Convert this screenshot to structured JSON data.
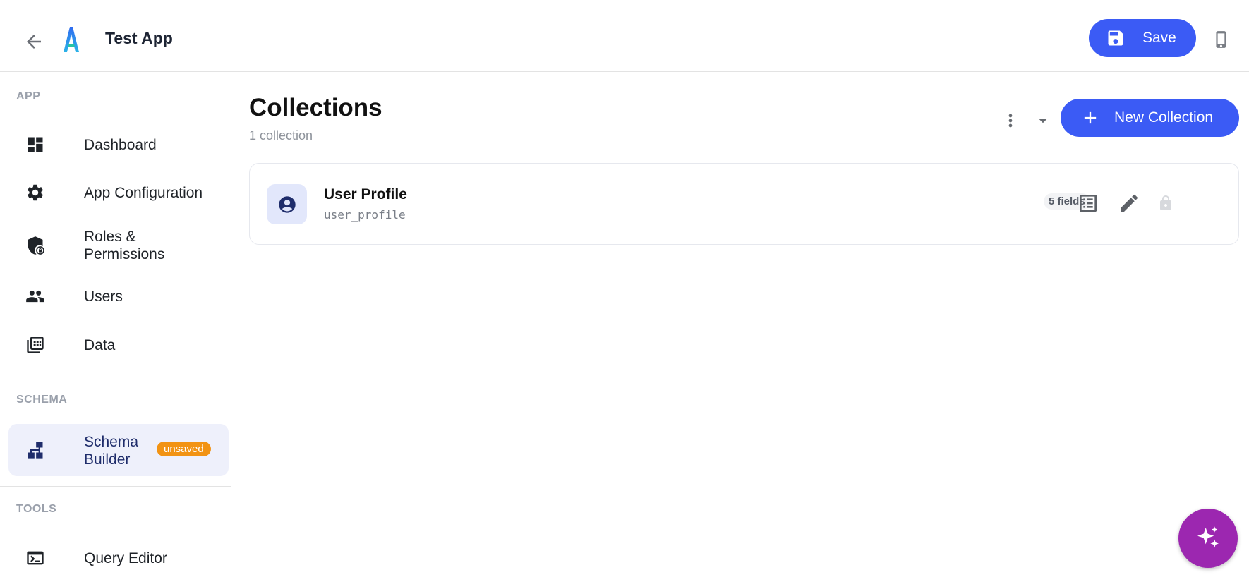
{
  "header": {
    "app_title": "Test App",
    "save_label": "Save"
  },
  "sidebar": {
    "sections": {
      "app": "APP",
      "schema": "SCHEMA",
      "tools": "TOOLS"
    },
    "items": [
      {
        "label": "Dashboard",
        "icon": "dashboard-icon"
      },
      {
        "label": "App Configuration",
        "icon": "gear-icon"
      },
      {
        "label": "Roles &",
        "label2": "Permissions",
        "icon": "shield-lock-icon"
      },
      {
        "label": "Users",
        "icon": "users-icon"
      },
      {
        "label": "Data",
        "icon": "data-table-icon"
      },
      {
        "label": "Schema",
        "label2": "Builder",
        "icon": "schema-tree-icon",
        "badge": "unsaved",
        "active": true
      },
      {
        "label": "Query Editor",
        "icon": "terminal-icon"
      }
    ]
  },
  "main": {
    "title": "Collections",
    "subtitle": "1 collection",
    "new_collection_label": "New Collection",
    "collections": [
      {
        "name": "User Profile",
        "slug": "user_profile",
        "fields_badge": "5 fields",
        "icon": "account-circle-icon"
      }
    ]
  },
  "colors": {
    "primary": "#3b5bf5",
    "badge_warning": "#f29313",
    "fab": "#9c27b0",
    "active_bg": "#eef0fb",
    "navy_icon": "#1f2d6b"
  }
}
